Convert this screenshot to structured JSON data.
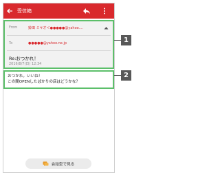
{
  "app_bar": {
    "title": "受信箱",
    "color": "#d9292d"
  },
  "header": {
    "from_label": "From",
    "from_value": "鈴田 ミキオ＜●●●●●@yahoo....",
    "to_label": "To",
    "to_value": "●●●●●@yahoo.ne.jp",
    "subject": "Re:おつかれ！",
    "date": "2016/8/7(日) 12:34"
  },
  "body": {
    "line1": "おつかれ。いいね！",
    "line2": "この間OPENしたばかりの店はどうかな？"
  },
  "conversation_button": {
    "label": "会話型で見る"
  },
  "callouts": {
    "one": "1",
    "two": "2"
  },
  "colors": {
    "highlight": "#5cbf6a",
    "callout_bg": "#585858"
  }
}
